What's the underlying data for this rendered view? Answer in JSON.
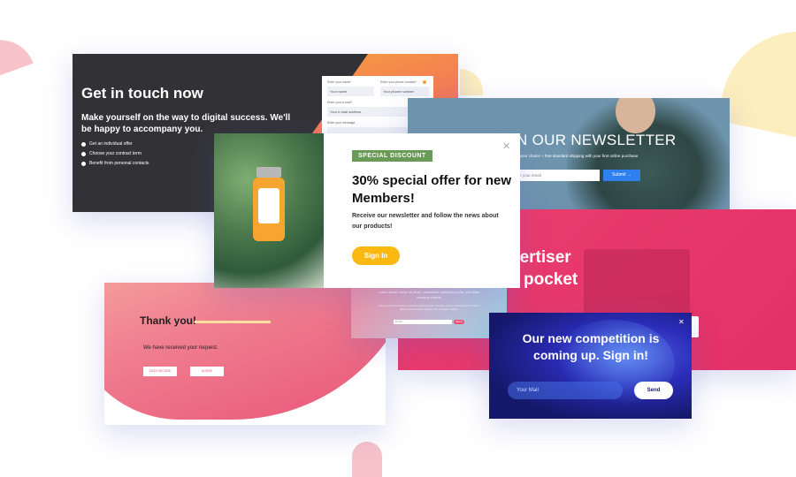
{
  "contact": {
    "title": "Get in touch now",
    "subtitle": "Make yourself on the way to digital success. We'll be happy to accompany you.",
    "bullets": [
      "Get an individual offer",
      "Choose your contract term",
      "Benefit from personal contacts"
    ],
    "form": {
      "name_label": "Enter your name*",
      "name_placeholder": "Your name",
      "phone_label": "Enter your phone number*",
      "phone_placeholder": "Your phone number",
      "email_label": "Enter your e-mail*",
      "email_placeholder": "Your e-mail address",
      "message_label": "Enter your message"
    }
  },
  "newsletter": {
    "title": "IN OUR NEWSLETTER",
    "subtitle": "n of your choice + free standard shipping with your first online purchase",
    "email_placeholder": "nter your email",
    "submit_label": "Submit →"
  },
  "discount": {
    "badge": "SPECIAL DISCOUNT",
    "title": "30% special offer for new Members!",
    "body": "Receive our newsletter and follow the news about our products!",
    "button": "Sign In",
    "close": "✕"
  },
  "advertiser": {
    "line1": "vertiser",
    "line2": "pocket"
  },
  "gradient_form": {
    "text": "Lorem ipsum dolor sit amet, consetetur sadipscing elitr, sed diam nonumy eirmod",
    "subtext": "Lorem ipsum dolor sit amet, consetetur sadipscing elitr, sed diam nonumy eirmod tempor invidunt ut labore et dolore magna aliquyam erat, sed diam voluptua.",
    "input_placeholder": "Email",
    "button": "Send"
  },
  "thankyou": {
    "title": "Thank you!",
    "message": "We have received your request.",
    "button1": "DATA SECURE",
    "button2": "AGREE"
  },
  "competition": {
    "title": "Our new competition is coming up. Sign in!",
    "email_placeholder": "Your Mail",
    "button": "Send",
    "close": "✕"
  },
  "colors": {
    "dark": "#323236",
    "pink": "#e8346a",
    "orange": "#f6a13a",
    "steel_blue": "#6f95ae",
    "green_badge": "#6a9a57",
    "yellow": "#fbb813",
    "navy": "#1a1e6e",
    "blue_button": "#2f7ff0"
  }
}
